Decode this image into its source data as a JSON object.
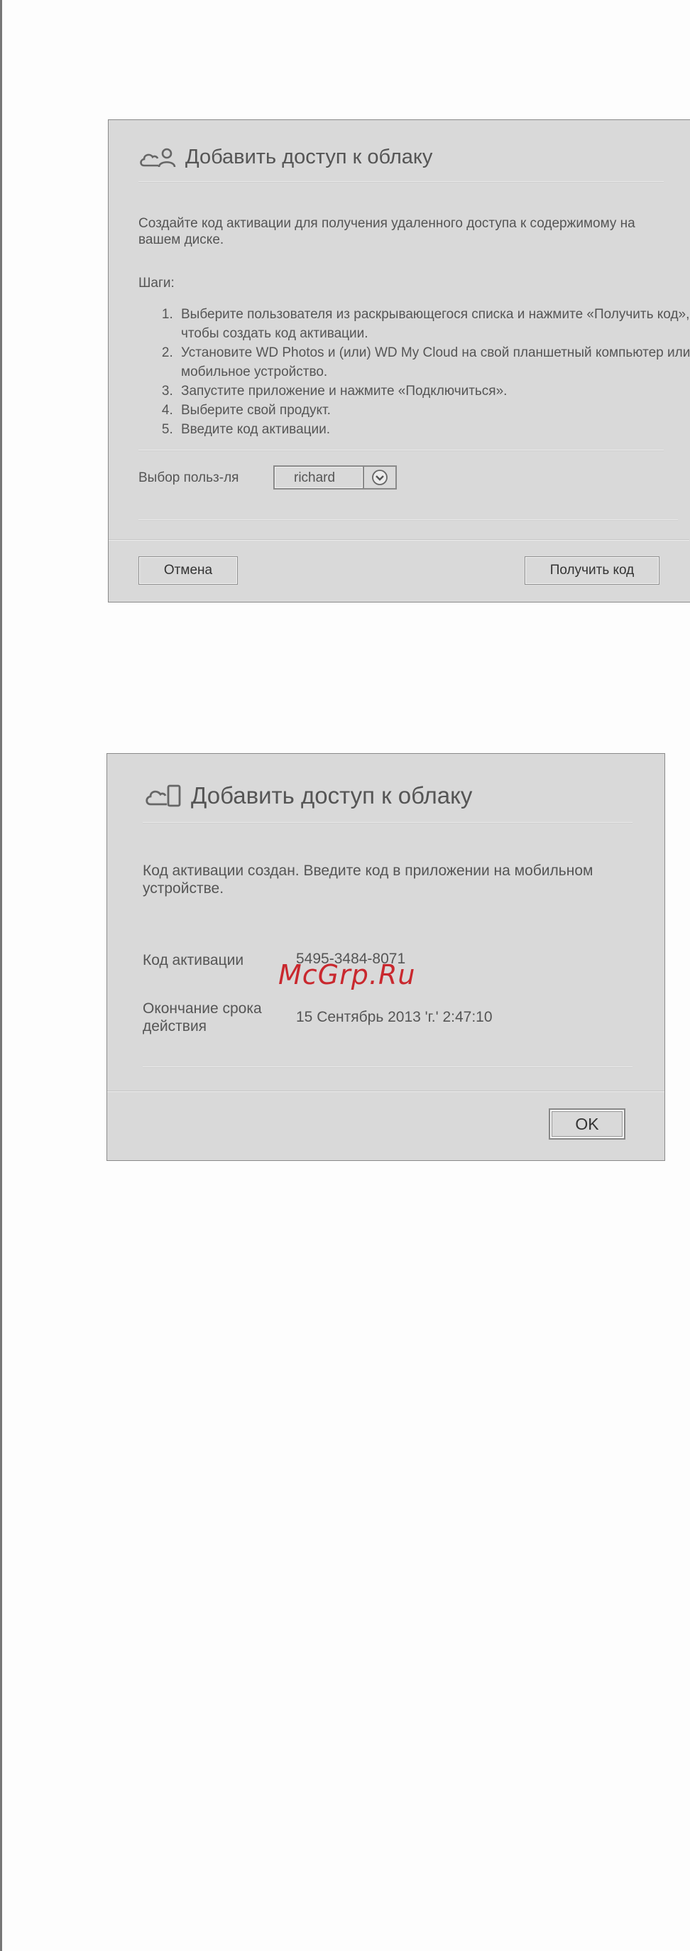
{
  "dialog_request": {
    "title": "Добавить доступ к облаку",
    "intro": "Создайте код активации для получения удаленного доступа к содержимому на вашем диске.",
    "steps_label": "Шаги:",
    "steps": [
      "Выберите пользователя из раскрывающегося списка и нажмите «Получить код», чтобы создать код активации.",
      "Установите WD Photos и (или) WD My Cloud на свой планшетный компьютер или мобильное устройство.",
      "Запустите приложение и нажмите «Подключиться».",
      "Выберите свой продукт.",
      "Введите код активации."
    ],
    "user_select_label": "Выбор польз-ля",
    "user_select_value": "richard",
    "cancel_label": "Отмена",
    "get_code_label": "Получить код"
  },
  "dialog_result": {
    "title": "Добавить доступ к облаку",
    "message": "Код активации создан. Введите код в приложении на мобильном устройстве.",
    "code_label": "Код активации",
    "code_value": "5495-3484-8071",
    "expiry_label": "Окончание срока действия",
    "expiry_value": "15 Сентябрь 2013 'г.' 2:47:10",
    "ok_label": "OK"
  },
  "watermark": "McGrp.Ru",
  "icons": {
    "cloud_user": "cloud-user-icon",
    "cloud_device": "cloud-device-icon",
    "dropdown": "chevron-down-icon"
  },
  "colors": {
    "dialog_bg": "#d9d9d9",
    "text": "#555555",
    "watermark": "#c9282e"
  }
}
